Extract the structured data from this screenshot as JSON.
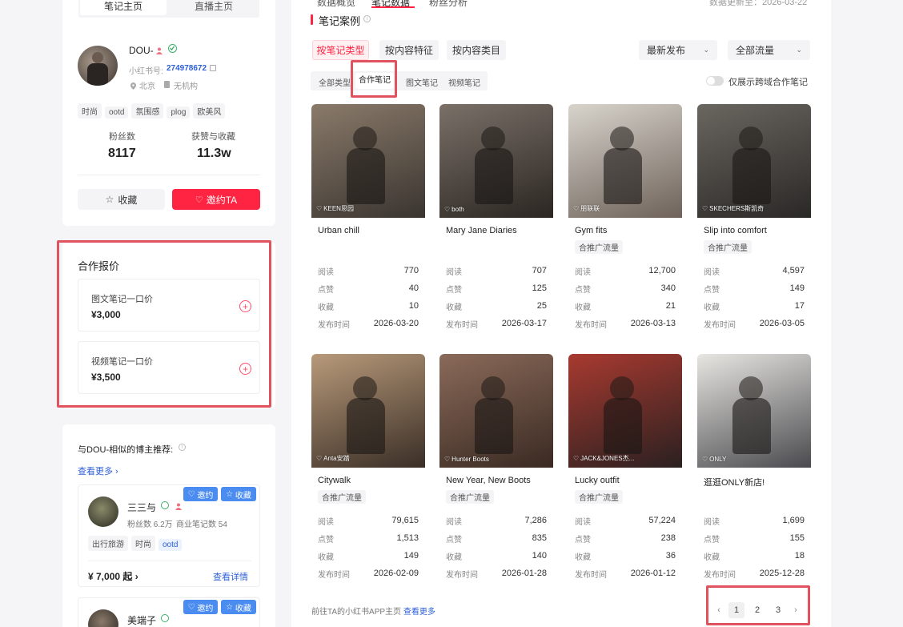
{
  "left_tabs": {
    "notes_home": "笔记主页",
    "live_home": "直播主页"
  },
  "profile": {
    "name": "DOU-",
    "id_label": "小红书号:",
    "id_value": "274978672",
    "location": "北京",
    "org": "无机构",
    "tags": [
      "时尚",
      "ootd",
      "氛围感",
      "plog",
      "欧美风"
    ],
    "fans_label": "粉丝数",
    "fans_value": "8117",
    "likes_label": "获赞与收藏",
    "likes_value": "11.3w",
    "fav_btn": "收藏",
    "invite_btn": "邀约TA"
  },
  "pricing": {
    "title": "合作报价",
    "items": [
      {
        "label": "图文笔记一口价",
        "price": "¥3,000"
      },
      {
        "label": "视频笔记一口价",
        "price": "¥3,500"
      }
    ]
  },
  "similar": {
    "title": "与DOU-相似的博主推荐:",
    "see_more": "查看更多",
    "invite_label": "邀约",
    "fav_label": "收藏",
    "blogger1": {
      "name": "三三与",
      "fans": "粉丝数 6.2万",
      "biz": "商业笔记数 54",
      "tags": [
        "出行旅游",
        "时尚",
        "ootd"
      ],
      "price": "¥ 7,000 起",
      "details": "查看详情"
    },
    "blogger2": {
      "name": "美端子"
    }
  },
  "top_tabs": {
    "overview": "数据概览",
    "notes_data": "笔记数据",
    "fans": "粉丝分析",
    "update": "数据更新至：2026-03-22"
  },
  "notes_section": {
    "title": "笔记案例",
    "filter_tabs": [
      "按笔记类型",
      "按内容特征",
      "按内容类目"
    ],
    "sort": "最新发布",
    "traffic": "全部流量",
    "type_tabs": [
      "全部类型",
      "合作笔记",
      "图文笔记",
      "视频笔记"
    ],
    "toggle_label": "仅展示跨域合作笔记",
    "stat_labels": {
      "read": "阅读",
      "like": "点赞",
      "fav": "收藏",
      "date": "发布时间"
    },
    "coop_tag": "合推广流量",
    "notes": [
      {
        "title": "Urban chill",
        "brand": "KEEN思园",
        "coop": false,
        "read": "770",
        "like": "40",
        "fav": "10",
        "date": "2026-03-20",
        "c1": "#8a7a6a",
        "c2": "#3a3530"
      },
      {
        "title": "Mary Jane Diaries",
        "brand": "both",
        "coop": false,
        "read": "707",
        "like": "125",
        "fav": "25",
        "date": "2026-03-17",
        "c1": "#7a7068",
        "c2": "#2b2622"
      },
      {
        "title": "Gym fits",
        "brand": "朋联联",
        "coop": true,
        "read": "12,700",
        "like": "340",
        "fav": "21",
        "date": "2026-03-13",
        "c1": "#d8d4cc",
        "c2": "#6e625a"
      },
      {
        "title": "Slip into comfort",
        "brand": "SKECHERS斯凯奇",
        "coop": true,
        "read": "4,597",
        "like": "149",
        "fav": "17",
        "date": "2026-03-05",
        "c1": "#6a6660",
        "c2": "#2a2826"
      },
      {
        "title": "Citywalk",
        "brand": "Anta安踏",
        "coop": true,
        "read": "79,615",
        "like": "1,513",
        "fav": "149",
        "date": "2026-02-09",
        "c1": "#b89a7a",
        "c2": "#3a2e26"
      },
      {
        "title": "New Year, New Boots",
        "brand": "Hunter Boots",
        "coop": true,
        "read": "7,286",
        "like": "835",
        "fav": "140",
        "date": "2026-01-28",
        "c1": "#8a6a5a",
        "c2": "#3a2a22"
      },
      {
        "title": "Lucky outfit",
        "brand": "JACK&JONES杰...",
        "coop": true,
        "read": "57,224",
        "like": "238",
        "fav": "36",
        "date": "2026-01-12",
        "c1": "#a83a30",
        "c2": "#2a2020"
      },
      {
        "title": "逛逛ONLY新店!",
        "brand": "ONLY",
        "coop": false,
        "read": "1,699",
        "like": "155",
        "fav": "18",
        "date": "2025-12-28",
        "c1": "#e8e6e2",
        "c2": "#4a4a4e"
      }
    ],
    "footer_text": "前往TA的小红书APP主页",
    "footer_link": "查看更多",
    "pages": [
      "1",
      "2",
      "3"
    ]
  },
  "colors": {
    "accent": "#ff2442",
    "link": "#2d5fd8",
    "annot": "#e0525e"
  }
}
